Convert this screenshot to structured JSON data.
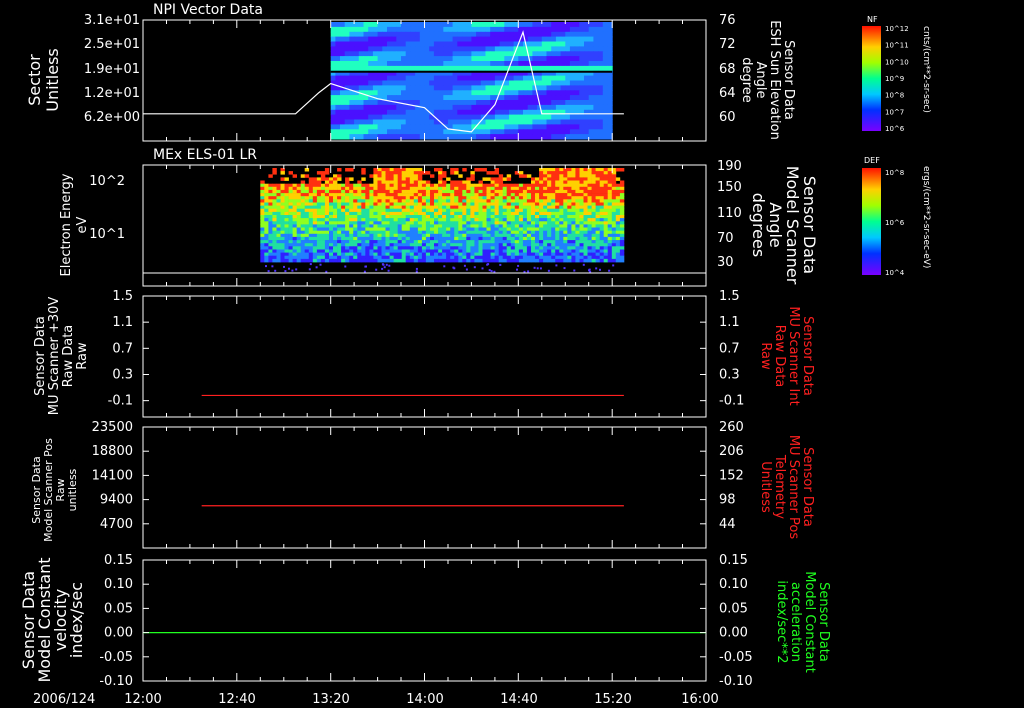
{
  "chart_data": [
    {
      "type": "heatmap",
      "title": "NPI Vector Data",
      "ylabel": [
        "Sector",
        "Unitless"
      ],
      "yticks": [
        "3.1e+01",
        "2.5e+01",
        "1.9e+01",
        "1.2e+01",
        "6.2e+00"
      ],
      "right_label": [
        "Sensor Data",
        "ESH Sun Elevation",
        "Angle",
        "degree"
      ],
      "right_ticks": [
        "76",
        "72",
        "68",
        "64",
        "60"
      ],
      "right_ylim": [
        56,
        76
      ],
      "overlay_line": {
        "x": [
          "12:40",
          "13:05",
          "13:15",
          "13:20",
          "13:40",
          "14:00",
          "14:10",
          "14:20",
          "14:30",
          "14:38",
          "14:42",
          "14:50",
          "15:00",
          "15:25"
        ],
        "y": [
          60.5,
          60.5,
          64,
          65.5,
          63,
          61.5,
          58,
          57.5,
          62,
          70,
          74,
          60.5,
          60.5,
          60.5
        ]
      },
      "colorbar": {
        "label": "NF",
        "units": "cnts/(cm**2-sr-sec)",
        "ticks": [
          "10^12",
          "10^11",
          "10^10",
          "10^9",
          "10^8",
          "10^7",
          "10^6"
        ]
      }
    },
    {
      "type": "heatmap",
      "title": "MEx ELS-01 LR",
      "ylabel": [
        "Electron Energy",
        "eV"
      ],
      "yticks": [
        "10^2",
        "10^1"
      ],
      "right_label": [
        "Sensor Data",
        "Model Scanner",
        "Angle",
        "degrees"
      ],
      "right_ticks": [
        "190",
        "150",
        "110",
        "70",
        "30"
      ],
      "right_ylim": [
        0,
        190
      ],
      "overlay_line": {
        "x": [
          "12:00",
          "16:00"
        ],
        "y": [
          20,
          20
        ]
      },
      "colorbar": {
        "label": "DEF",
        "units": "ergs/(cm**2-sr-sec-eV)",
        "ticks": [
          "10^8",
          "10^6",
          "10^4"
        ]
      }
    },
    {
      "type": "line",
      "ylabel": [
        "Sensor Data",
        "MU Scanner +30V",
        "Raw Data",
        "Raw"
      ],
      "yticks": [
        "1.5",
        "1.1",
        "0.7",
        "0.3",
        "-0.1"
      ],
      "ylim": [
        -0.35,
        1.5
      ],
      "right_label": [
        "Sensor Data",
        "MU Scanner Int",
        "Raw Data",
        "Raw"
      ],
      "right_ticks": [
        "1.5",
        "1.1",
        "0.7",
        "0.3",
        "-0.1"
      ],
      "series": [
        {
          "color": "#ff2020",
          "x": [
            "12:25",
            "15:25"
          ],
          "y": [
            -0.02,
            -0.02
          ]
        }
      ]
    },
    {
      "type": "line",
      "ylabel": [
        "Sensor Data",
        "Model Scanner Pos",
        "Raw",
        "unitless"
      ],
      "yticks": [
        "23500",
        "18800",
        "14100",
        "9400",
        "4700"
      ],
      "ylim": [
        0,
        23500
      ],
      "right_label": [
        "Sensor Data",
        "MU Scanner Pos",
        "Telemetry",
        "Unitless"
      ],
      "right_ticks": [
        "260",
        "206",
        "152",
        "98",
        "44"
      ],
      "series": [
        {
          "color": "#ff2020",
          "x": [
            "12:25",
            "15:25"
          ],
          "y": [
            8200,
            8200
          ]
        }
      ]
    },
    {
      "type": "line",
      "ylabel": [
        "Sensor Data",
        "Model Constant",
        "velocity",
        "index/sec"
      ],
      "yticks": [
        "0.15",
        "0.10",
        "0.05",
        "0.00",
        "-0.05",
        "-0.10"
      ],
      "ylim": [
        -0.1,
        0.15
      ],
      "right_label": [
        "Sensor Data",
        "Model Constant",
        "acceleration",
        "index/sec**2"
      ],
      "right_ticks": [
        "0.15",
        "0.10",
        "0.05",
        "0.00",
        "-0.05",
        "-0.10"
      ],
      "series": [
        {
          "color": "#20ff20",
          "x": [
            "12:00",
            "16:00"
          ],
          "y": [
            0.0,
            0.0
          ]
        }
      ]
    }
  ],
  "xaxis": {
    "date": "2006/124",
    "ticks": [
      "12:00",
      "12:40",
      "13:20",
      "14:00",
      "14:40",
      "15:20",
      "16:00"
    ],
    "range": [
      "12:00",
      "16:00"
    ]
  },
  "colors": {
    "line_left": "#ff2020",
    "line_right_green": "#20ff20",
    "label_red": "#ff2020",
    "label_green": "#20ff20"
  }
}
